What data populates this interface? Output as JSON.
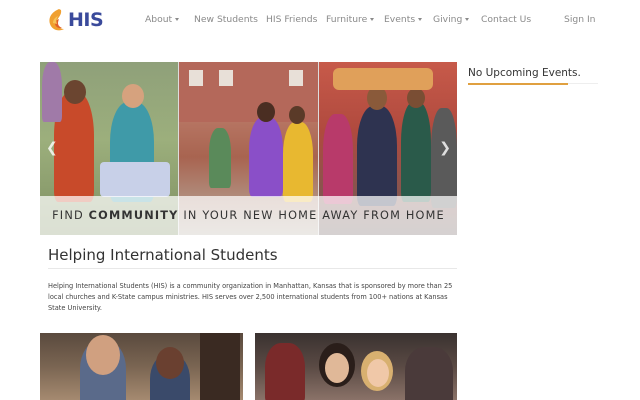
{
  "brand": {
    "logo_text": "HIS",
    "accent_color": "#3a4a9b",
    "logo_color": "#f0a030"
  },
  "nav": {
    "items": [
      {
        "label": "About",
        "dropdown": true
      },
      {
        "label": "New Students",
        "dropdown": false
      },
      {
        "label": "HIS Friends",
        "dropdown": false
      },
      {
        "label": "Furniture",
        "dropdown": true
      },
      {
        "label": "Events",
        "dropdown": true
      },
      {
        "label": "Giving",
        "dropdown": true
      },
      {
        "label": "Contact Us",
        "dropdown": false
      }
    ],
    "sign_in": "Sign In"
  },
  "hero": {
    "caption_pre": "FIND ",
    "caption_bold": "COMMUNITY",
    "caption_post": " IN YOUR NEW HOME AWAY FROM HOME",
    "prev_icon": "chevron-left-icon",
    "next_icon": "chevron-right-icon"
  },
  "sidebar": {
    "events_title": "No Upcoming Events.",
    "underline_color": "#e0a040"
  },
  "main": {
    "title": "Helping International Students",
    "intro": "Helping International Students (HIS) is a community organization in Manhattan, Kansas that is sponsored by more than 25 local churches and K-State campus ministries. HIS serves over 2,500 international students from 100+ nations at Kansas State University."
  }
}
